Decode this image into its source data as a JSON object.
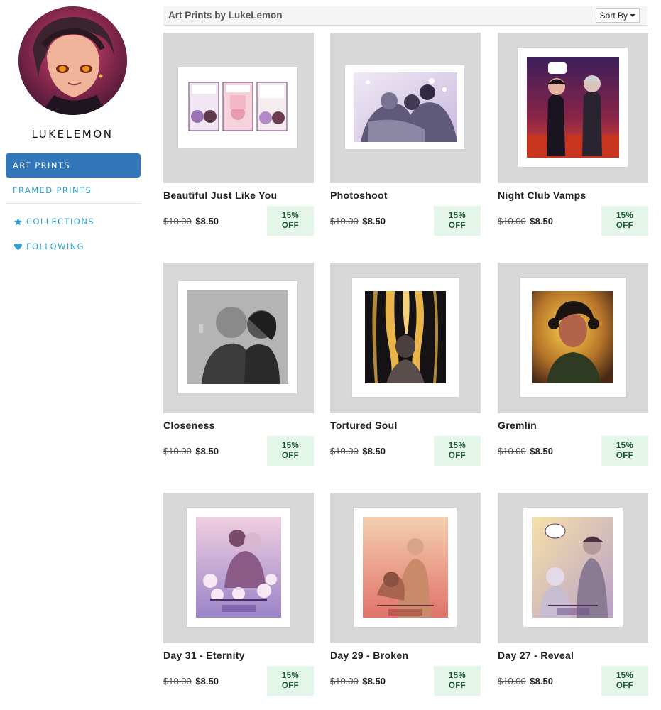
{
  "sidebar": {
    "username": "LUKELEMON",
    "nav": [
      {
        "label": "ART PRINTS",
        "active": true,
        "icon": ""
      },
      {
        "label": "FRAMED PRINTS",
        "active": false,
        "icon": ""
      },
      {
        "label": "COLLECTIONS",
        "active": false,
        "icon": "star-icon"
      },
      {
        "label": "FOLLOWING",
        "active": false,
        "icon": "heart-icon"
      }
    ]
  },
  "header": {
    "title": "Art Prints by LukeLemon",
    "sort_label": "Sort By"
  },
  "colors": {
    "accent": "#3277b9",
    "link": "#2fa0d1",
    "discount_bg": "#e4f6ea",
    "discount_text": "#1b5a34",
    "thumb_bg": "#d8d8d8"
  },
  "products": [
    {
      "title": "Beautiful Just Like You",
      "old_price": "$10.00",
      "price": "$8.50",
      "discount_pct": "15%",
      "discount_label": "OFF"
    },
    {
      "title": "Photoshoot",
      "old_price": "$10.00",
      "price": "$8.50",
      "discount_pct": "15%",
      "discount_label": "OFF"
    },
    {
      "title": "Night Club Vamps",
      "old_price": "$10.00",
      "price": "$8.50",
      "discount_pct": "15%",
      "discount_label": "OFF"
    },
    {
      "title": "Closeness",
      "old_price": "$10.00",
      "price": "$8.50",
      "discount_pct": "15%",
      "discount_label": "OFF"
    },
    {
      "title": "Tortured Soul",
      "old_price": "$10.00",
      "price": "$8.50",
      "discount_pct": "15%",
      "discount_label": "OFF"
    },
    {
      "title": "Gremlin",
      "old_price": "$10.00",
      "price": "$8.50",
      "discount_pct": "15%",
      "discount_label": "OFF"
    },
    {
      "title": "Day 31 - Eternity",
      "old_price": "$10.00",
      "price": "$8.50",
      "discount_pct": "15%",
      "discount_label": "OFF"
    },
    {
      "title": "Day 29 - Broken",
      "old_price": "$10.00",
      "price": "$8.50",
      "discount_pct": "15%",
      "discount_label": "OFF"
    },
    {
      "title": "Day 27 - Reveal",
      "old_price": "$10.00",
      "price": "$8.50",
      "discount_pct": "15%",
      "discount_label": "OFF"
    }
  ]
}
